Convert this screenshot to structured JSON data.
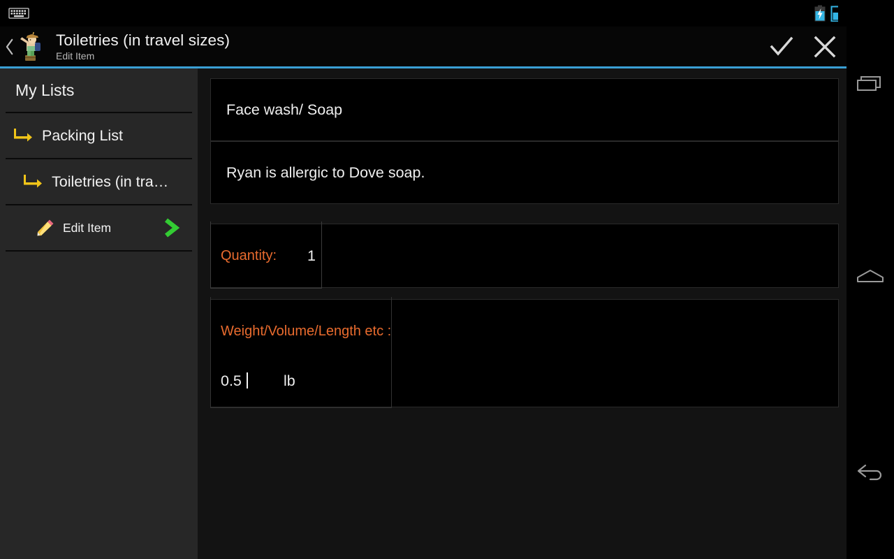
{
  "statusbar": {
    "keyboard_icon": "keyboard-icon",
    "battery_icon": "battery-charging-icon",
    "battery_partial_icon": "battery-icon-partial"
  },
  "actionbar": {
    "back_icon": "back-chevron-icon",
    "app_icon": "traveler-app-icon",
    "title": "Toiletries (in travel sizes)",
    "subtitle": "Edit Item",
    "accept_icon": "checkmark-icon",
    "cancel_icon": "close-x-icon",
    "accent_color": "#3a9fd4"
  },
  "sidebar": {
    "header": "My Lists",
    "items": [
      {
        "label": "Packing List",
        "icon": "arrow-branch-icon",
        "level": 1
      },
      {
        "label": "Toiletries (in tra…",
        "icon": "arrow-branch-icon",
        "level": 2
      },
      {
        "label": "Edit Item",
        "icon": "pencil-icon",
        "chevron": "chevron-right-icon",
        "level": 3
      }
    ],
    "accent_yellow": "#f0c419",
    "accent_green": "#33cc33",
    "background": "#272727"
  },
  "main": {
    "item_name": "Face wash/ Soap",
    "item_note": "Ryan is allergic to Dove soap.",
    "quantity_label": "Quantity:",
    "quantity_value": "1",
    "measure_label": "Weight/Volume/Length etc :",
    "measure_value": "0.5",
    "measure_unit": "lb",
    "label_color": "#e86b2e"
  },
  "navbar": {
    "recent_icon": "recent-apps-icon",
    "home_icon": "home-icon",
    "back_icon": "back-arrow-icon"
  }
}
